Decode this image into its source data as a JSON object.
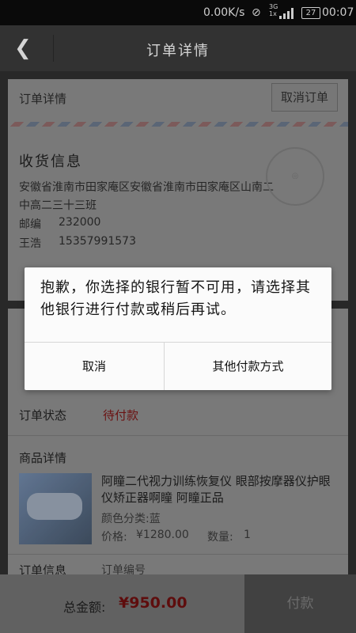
{
  "status_bar": {
    "speed": "0.00K/s",
    "network": "3G",
    "network_sub": "1x",
    "battery": "27",
    "time": "00:07"
  },
  "titlebar": {
    "title": "订单详情"
  },
  "order_card": {
    "header": "订单详情",
    "cancel_button": "取消订单",
    "address_title": "收货信息",
    "address_line1": "安徽省淮南市田家庵区安徽省淮南市田家庵区山南二",
    "address_line2": "中高二三十三班",
    "postcode_label": "邮编",
    "postcode": "232000",
    "name": "王浩",
    "phone": "15357991573"
  },
  "order_status": {
    "label": "订单状态",
    "value": "待付款"
  },
  "goods": {
    "section_title": "商品详情",
    "title": "阿瞳二代视力训练恢复仪 眼部按摩器仪护眼仪矫正器啊瞳 阿瞳正品",
    "color_label": "颜色分类:蓝",
    "price_label": "价格:",
    "price": "¥1280.00",
    "quantity_label": "数量:",
    "quantity": "1"
  },
  "order_info": {
    "label": "订单信息",
    "number_label": "订单编号"
  },
  "bottom": {
    "total_label": "总金额:",
    "total_amount": "¥950.00",
    "pay_button": "付款"
  },
  "dialog": {
    "message": "抱歉，你选择的银行暂不可用，请选择其他银行进行付款或稍后再试。",
    "cancel": "取消",
    "other": "其他付款方式"
  },
  "colors": {
    "accent_price": "#c01818",
    "dialog_bg": "#fbfbfb"
  }
}
